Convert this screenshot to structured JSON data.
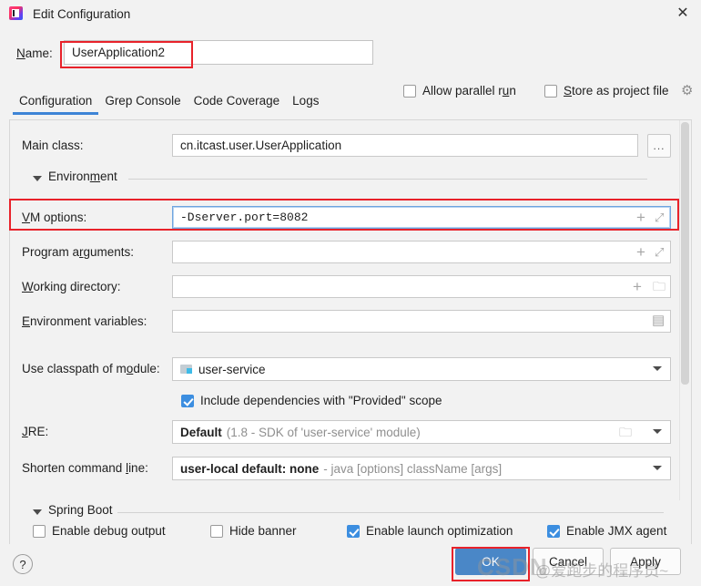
{
  "window": {
    "title": "Edit Configuration",
    "app_icon": "intellij-idea-icon",
    "close_icon": "✕"
  },
  "name_row": {
    "label": "Name:",
    "value": "UserApplication2",
    "allow_parallel_run": "Allow parallel run",
    "allow_parallel_run_checked": false,
    "store_as_project_file": "Store as project file",
    "store_as_project_file_checked": false,
    "gear_icon": "⚙"
  },
  "tabs": [
    {
      "label": "Configuration",
      "active": true
    },
    {
      "label": "Grep Console",
      "active": false
    },
    {
      "label": "Code Coverage",
      "active": false
    },
    {
      "label": "Logs",
      "active": false
    }
  ],
  "form": {
    "main_class": {
      "label": "Main class:",
      "value": "cn.itcast.user.UserApplication",
      "browse_label": "..."
    },
    "environment_section": {
      "label": "Environment"
    },
    "vm_options": {
      "label": "VM options:",
      "value": "-Dserver.port=8082",
      "add_icon": "+",
      "expand_icon": "⤢"
    },
    "program_arguments": {
      "label": "Program arguments:",
      "value": "",
      "add_icon": "+",
      "expand_icon": "⤢"
    },
    "working_directory": {
      "label": "Working directory:",
      "value": "",
      "add_icon": "+",
      "folder_icon": "🗀"
    },
    "environment_variables": {
      "label": "Environment variables:",
      "value": "",
      "doc_icon": "▤"
    },
    "use_classpath_of_module": {
      "label": "Use classpath of module:",
      "value": "user-service",
      "module_icon": "module-folder-icon"
    },
    "include_provided": {
      "label": "Include dependencies with \"Provided\" scope",
      "checked": true
    },
    "jre": {
      "label": "JRE:",
      "value": "Default",
      "hint": "(1.8 - SDK of 'user-service' module)",
      "folder_icon": "🗀"
    },
    "shorten_command_line": {
      "label": "Shorten command line:",
      "value": "user-local default: none",
      "hint": "- java [options] className [args]"
    }
  },
  "spring_boot": {
    "section_label": "Spring Boot",
    "checkboxes": [
      {
        "label": "Enable debug output",
        "checked": false
      },
      {
        "label": "Hide banner",
        "checked": false
      },
      {
        "label": "Enable launch optimization",
        "checked": true
      },
      {
        "label": "Enable JMX agent",
        "checked": true
      }
    ]
  },
  "footer": {
    "help_label": "?",
    "ok_label": "OK",
    "cancel_label": "Cancel",
    "apply_label": "Apply"
  },
  "watermark": {
    "brand": "CSDN",
    "handle": "@爱跑步的程序员~"
  },
  "colors": {
    "accent_blue": "#3d84d6",
    "ok_button": "#4a87c7",
    "highlight_red": "#e8222a",
    "checkbox_checked": "#3c8ee0",
    "panel_bg": "#f2f2f2"
  }
}
